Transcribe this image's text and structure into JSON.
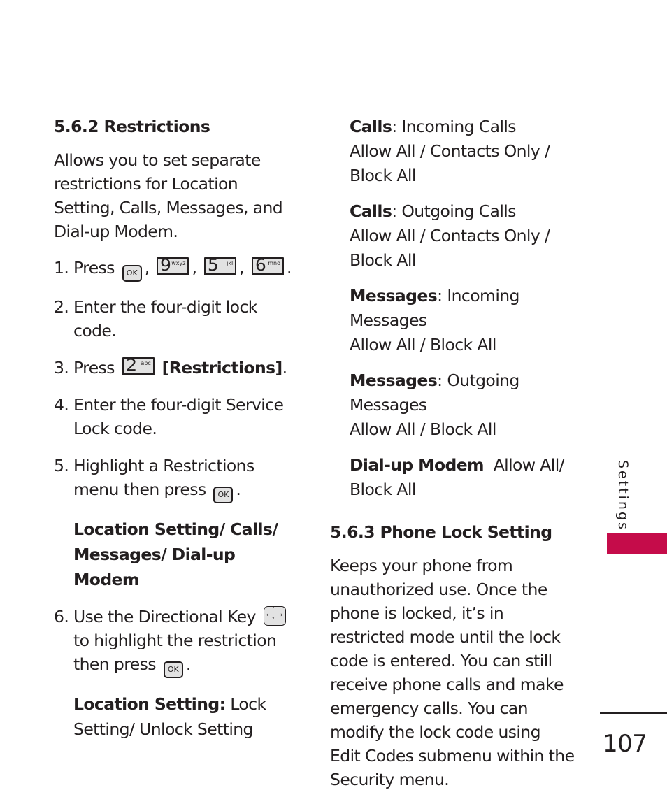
{
  "page": {
    "section_tab_label": "Settings",
    "accent_color": "#c50c4a",
    "page_number": "107"
  },
  "left": {
    "heading": "5.6.2 Restrictions",
    "intro": "Allows you to set separate restrictions for Location Setting, Calls, Messages, and Dial-up Modem.",
    "steps": [
      {
        "num": "1.",
        "text": "Press",
        "keys": [
          {
            "icon": "ok-key-icon",
            "label": "OK"
          },
          {
            "icon": "9-key-icon",
            "digit": "9",
            "letters": "wxyz"
          },
          {
            "icon": "5-key-icon",
            "digit": "5",
            "letters": "jkl"
          },
          {
            "icon": "6-key-icon",
            "digit": "6",
            "letters": "mno"
          }
        ]
      },
      {
        "num": "2.",
        "text": "Enter the four-digit lock code."
      },
      {
        "num": "3.",
        "text": "Press",
        "key": {
          "icon": "2-key-icon",
          "digit": "2",
          "letters": "abc"
        },
        "bold_text": "[Restrictions]"
      },
      {
        "num": "4.",
        "text": "Enter the four-digit Service Lock code."
      },
      {
        "num": "5.",
        "text": "Highlight a Restrictions menu then press",
        "key": {
          "icon": "ok-key-icon",
          "label": "OK"
        }
      },
      {
        "num": "6.",
        "text_before": "Use the Directional Key",
        "text_after": "to highlight the restriction then press",
        "key": {
          "icon": "ok-key-icon",
          "label": "OK"
        }
      }
    ],
    "menu_line1": "Location Setting/ Calls/",
    "menu_line2": "Messages/ Dial-up Modem",
    "location_setting_label": "Location Setting:",
    "location_setting_options_line1": "Lock",
    "location_setting_options_line2": "Setting/ Unlock Setting"
  },
  "right": {
    "options": [
      {
        "label": "Calls",
        "sep": ":",
        "target": "Incoming Calls",
        "line2": "Allow All / Contacts Only /",
        "line3": "Block All"
      },
      {
        "label": "Calls",
        "sep": ":",
        "target": "Outgoing Calls",
        "line2": "Allow All / Contacts Only /",
        "line3": "Block All"
      },
      {
        "label": "Messages",
        "sep": ":",
        "target": "Incoming Messages",
        "line2": "Allow All / Block All"
      },
      {
        "label": "Messages",
        "sep": ":",
        "target": "Outgoing Messages",
        "line2": "Allow All / Block All"
      },
      {
        "label": "Dial-up Modem",
        "sep": "",
        "target": "Allow All/",
        "line2": "Block All"
      }
    ],
    "heading": "5.6.3 Phone Lock Setting",
    "body": "Keeps your phone from unauthorized use. Once the phone is locked, it’s in restricted mode until the lock code is entered. You can still receive phone calls and make emergency calls. You can modify the lock code using Edit Codes submenu within the Security menu."
  }
}
